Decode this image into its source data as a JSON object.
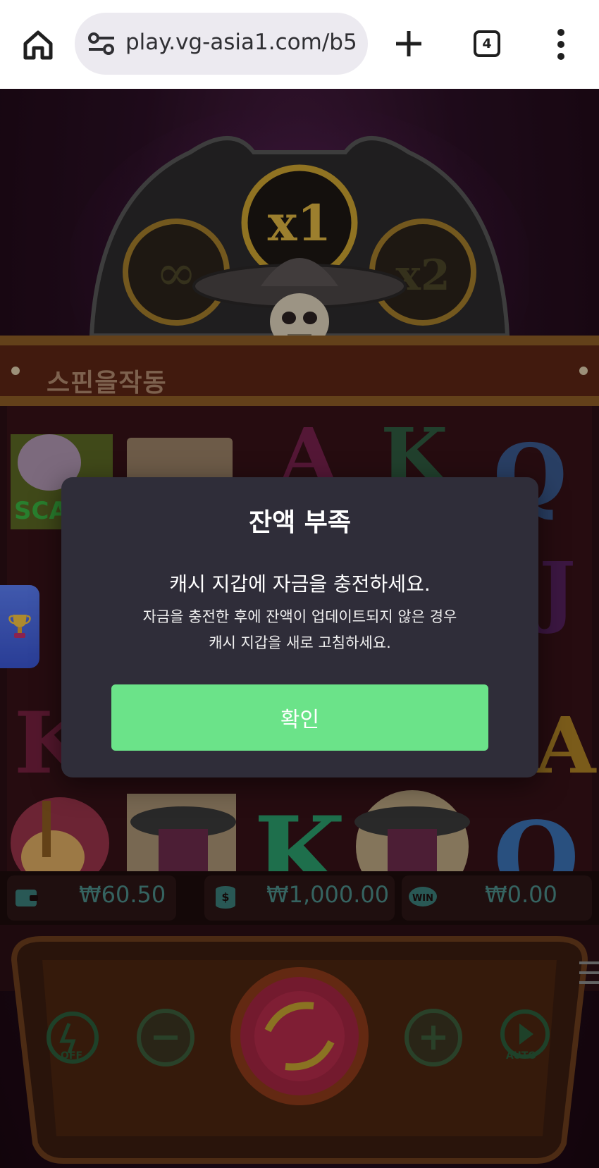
{
  "browser": {
    "url": "play.vg-asia1.com/b5",
    "tab_count": "4",
    "icons": [
      "home-icon",
      "site-settings-icon",
      "new-tab-icon",
      "tab-switcher-icon",
      "more-menu-icon"
    ]
  },
  "game": {
    "banner_label": "스핀을작동",
    "info": {
      "balance": "₩60.50",
      "bet": "₩1,000.00",
      "win": "₩0.00"
    },
    "controls": {
      "turbo_label": "OFF",
      "auto_label": "AUTO"
    }
  },
  "modal": {
    "title": "잔액 부족",
    "message": "캐시 지갑에 자금을 충전하세요.",
    "sub_line1": "자금을 충전한 후에 잔액이 업데이트되지 않은 경우",
    "sub_line2": "캐시 지갑을 새로 고침하세요.",
    "confirm_label": "확인"
  },
  "colors": {
    "modal_bg": "#2f2d39",
    "confirm_button": "#6be389",
    "info_text": "#4a8a86",
    "side_tab": "#4a68e0"
  }
}
